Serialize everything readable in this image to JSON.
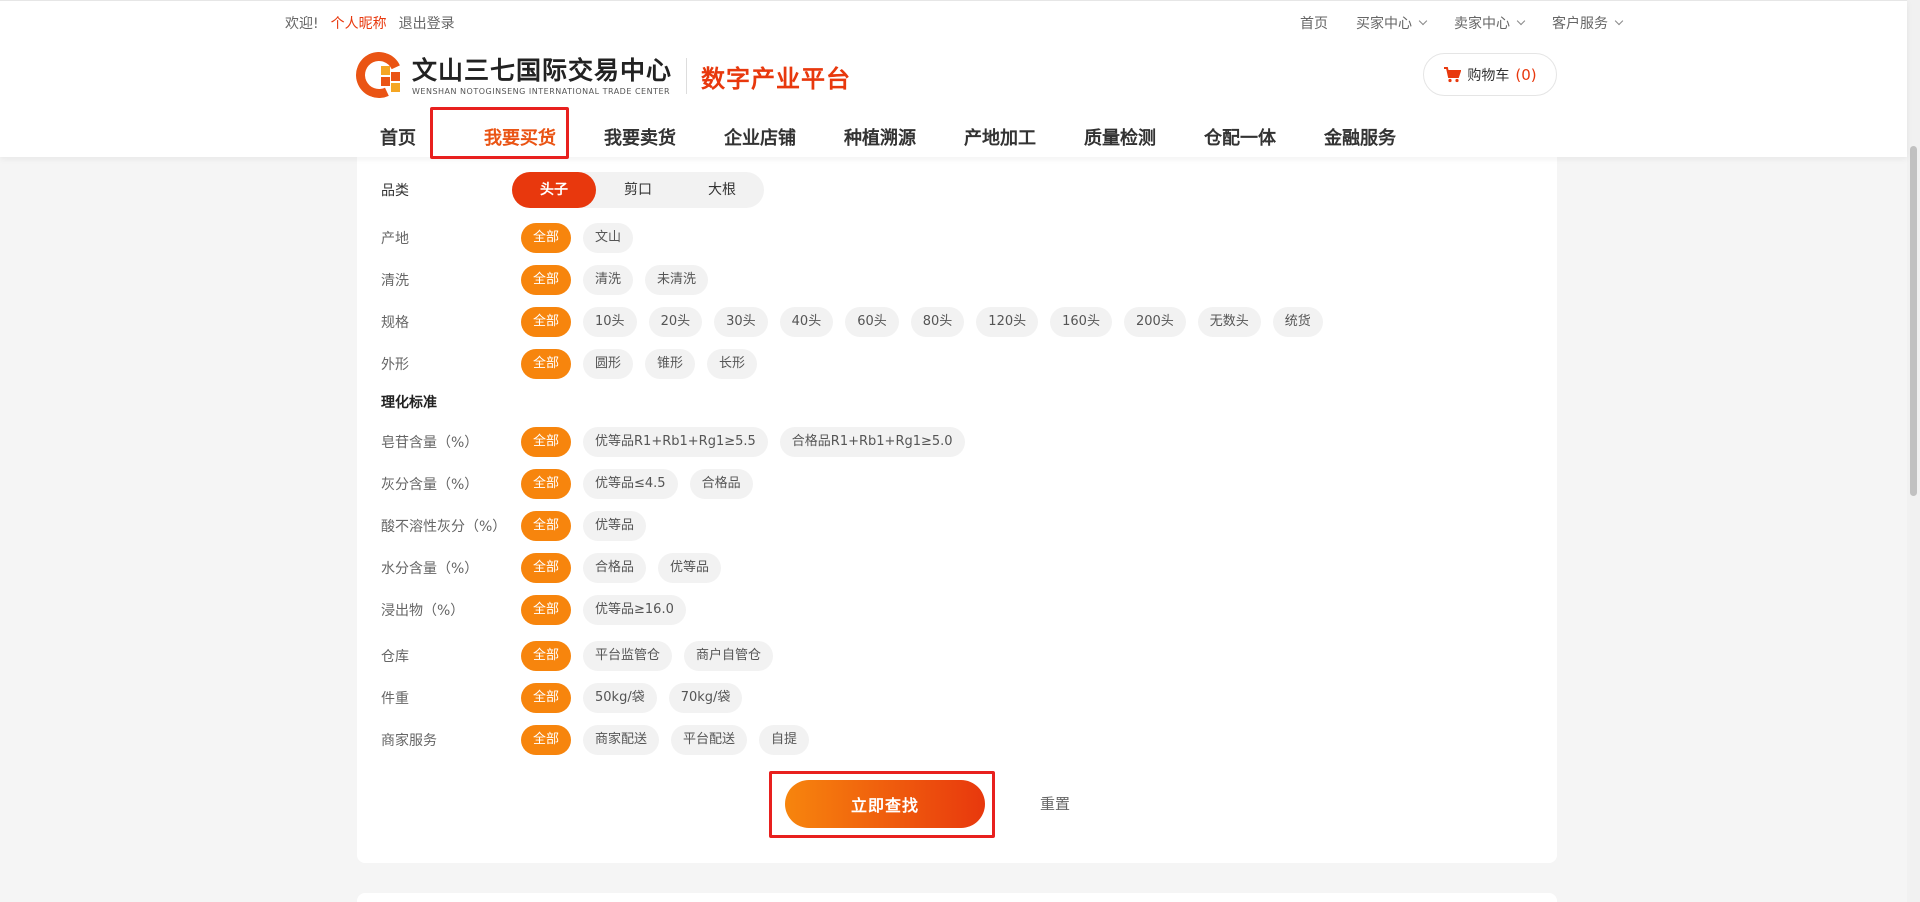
{
  "topbar": {
    "welcome": "欢迎!",
    "nickname": "个人昵称",
    "logout": "退出登录",
    "links": [
      {
        "label": "首页",
        "dropdown": false
      },
      {
        "label": "买家中心",
        "dropdown": true
      },
      {
        "label": "卖家中心",
        "dropdown": true
      },
      {
        "label": "客户服务",
        "dropdown": true
      }
    ]
  },
  "logo": {
    "name_cn": "文山三七国际交易中心",
    "name_en": "WENSHAN NOTOGINSENG INTERNATIONAL TRADE CENTER",
    "platform": "数字产业平台"
  },
  "cart": {
    "label": "购物车",
    "count": "(0)"
  },
  "nav": [
    "首页",
    "我要买货",
    "我要卖货",
    "企业店铺",
    "种植溯源",
    "产地加工",
    "质量检测",
    "仓配一体",
    "金融服务"
  ],
  "category": {
    "label": "品类",
    "options": [
      "头子",
      "剪口",
      "大根"
    ],
    "selected": "头子"
  },
  "filters": [
    {
      "label": "产地",
      "options": [
        "全部",
        "文山"
      ]
    },
    {
      "label": "清洗",
      "options": [
        "全部",
        "清洗",
        "未清洗"
      ]
    },
    {
      "label": "规格",
      "options": [
        "全部",
        "10头",
        "20头",
        "30头",
        "40头",
        "60头",
        "80头",
        "120头",
        "160头",
        "200头",
        "无数头",
        "统货"
      ]
    },
    {
      "label": "外形",
      "options": [
        "全部",
        "圆形",
        "锥形",
        "长形"
      ]
    }
  ],
  "standard_title": "理化标准",
  "standard_filters": [
    {
      "label": "皂苷含量（%）",
      "options": [
        "全部",
        "优等品R1+Rb1+Rg1≥5.5",
        "合格品R1+Rb1+Rg1≥5.0"
      ]
    },
    {
      "label": "灰分含量（%）",
      "options": [
        "全部",
        "优等品≤4.5",
        "合格品"
      ]
    },
    {
      "label": "酸不溶性灰分（%）",
      "options": [
        "全部",
        "优等品"
      ]
    },
    {
      "label": "水分含量（%）",
      "options": [
        "全部",
        "合格品",
        "优等品"
      ]
    },
    {
      "label": "浸出物（%）",
      "options": [
        "全部",
        "优等品≥16.0"
      ]
    }
  ],
  "other_filters": [
    {
      "label": "仓库",
      "options": [
        "全部",
        "平台监管仓",
        "商户自管仓"
      ]
    },
    {
      "label": "件重",
      "options": [
        "全部",
        "50kg/袋",
        "70kg/袋"
      ]
    },
    {
      "label": "商家服务",
      "options": [
        "全部",
        "商家配送",
        "平台配送",
        "自提"
      ]
    }
  ],
  "actions": {
    "search": "立即查找",
    "reset": "重置"
  },
  "colors": {
    "accent": "#e8380d",
    "orange": "#f7850d",
    "highlight": "#e8201e"
  }
}
